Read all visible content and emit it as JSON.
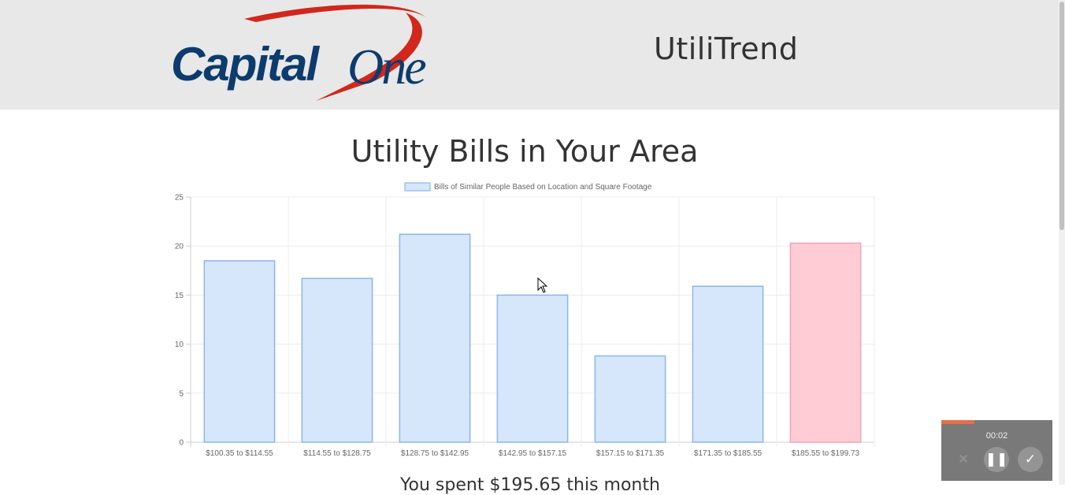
{
  "header": {
    "logo_text": "Capital One",
    "app_title": "UtiliTrend"
  },
  "page_title": "Utility Bills in Your Area",
  "footer_text": "You spent $195.65 this month",
  "player": {
    "time": "00:02",
    "progress": 0.3,
    "icons": [
      "close-icon",
      "pause-icon",
      "check-icon"
    ]
  },
  "colors": {
    "bar_fill": "#d6e6fb",
    "bar_border": "#8ab7ea",
    "highlight_fill": "#ffccd6",
    "highlight_border": "#f2a2b4",
    "logo_blue": "#0d3b6e",
    "logo_red": "#d1271c"
  },
  "chart_data": {
    "type": "bar",
    "categories": [
      "$100.35 to $114.55",
      "$114.55 to $128.75",
      "$128.75 to $142.95",
      "$142.95 to $157.15",
      "$157.15 to $171.35",
      "$171.35 to $185.55",
      "$185.55 to $199.73"
    ],
    "series": [
      {
        "name": "Bills of Similar People Based on Location and Square Footage",
        "values": [
          18.5,
          16.7,
          21.2,
          15,
          8.8,
          15.9,
          20.3
        ]
      }
    ],
    "highlight_index": 6,
    "ylim": [
      0,
      25
    ],
    "yticks": [
      0,
      5,
      10,
      15,
      20,
      25
    ],
    "grid": true,
    "legend_position": "top"
  }
}
